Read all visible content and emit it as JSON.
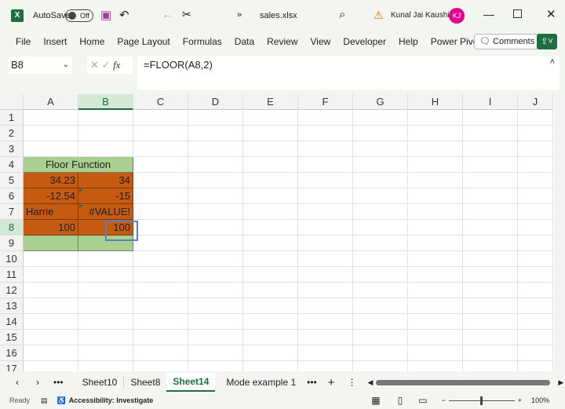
{
  "titlebar": {
    "autosave_label": "AutoSave",
    "autosave_state": "Off",
    "file_name": "sales.xlsx",
    "user_name": "Kunal Jai Kaushik",
    "user_initials": "KJ",
    "more": "»"
  },
  "ribbon": {
    "tabs": [
      "File",
      "Insert",
      "Home",
      "Page Layout",
      "Formulas",
      "Data",
      "Review",
      "View",
      "Developer",
      "Help",
      "Power Pivot"
    ],
    "comments_label": "Comments"
  },
  "formula_bar": {
    "name_box": "B8",
    "formula": "=FLOOR(A8,2)",
    "fx": "fx"
  },
  "columns": [
    "A",
    "B",
    "C",
    "D",
    "E",
    "F",
    "G",
    "H",
    "I",
    "J"
  ],
  "rows": [
    "1",
    "2",
    "3",
    "4",
    "5",
    "6",
    "7",
    "8",
    "9",
    "10",
    "11",
    "12",
    "13",
    "14",
    "15",
    "16",
    "17"
  ],
  "cells": {
    "A4": "Floor Function",
    "A5": "34.23",
    "B5": "34",
    "A6": "-12.54",
    "B6": "-15",
    "A7": "Harrie",
    "B7": "#VALUE!",
    "A8": "100",
    "B8": "100"
  },
  "colors": {
    "orange": "#c55a11",
    "green": "#a9d08e",
    "excel_green": "#1d6f42"
  },
  "sheets": {
    "tabs": [
      "Sheet10",
      "Sheet8",
      "Sheet14",
      "Mode example 1"
    ],
    "active": "Sheet14"
  },
  "status": {
    "ready": "Ready",
    "accessibility": "Accessibility: Investigate",
    "zoom": "100%"
  }
}
